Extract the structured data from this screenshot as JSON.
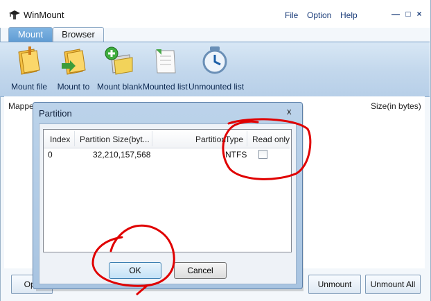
{
  "window": {
    "title": "WinMount"
  },
  "menu": {
    "file": "File",
    "option": "Option",
    "help": "Help"
  },
  "window_controls": {
    "minimize": "—",
    "maximize": "□",
    "close": "×"
  },
  "tabs": {
    "mount": "Mount",
    "browser": "Browser"
  },
  "toolbar": [
    {
      "label": "Mount file",
      "icon": "mount-file-icon"
    },
    {
      "label": "Mount to",
      "icon": "mount-to-icon"
    },
    {
      "label": "Mount blank",
      "icon": "mount-blank-icon"
    },
    {
      "label": "Mounted list",
      "icon": "mounted-list-icon"
    },
    {
      "label": "Unmounted list",
      "icon": "unmounted-list-icon"
    }
  ],
  "list": {
    "col_mapped": "Mappe",
    "col_size": "Size(in bytes)"
  },
  "bottom_buttons": {
    "open": "Ope",
    "unmount": "Unmount",
    "unmount_all": "Unmount All"
  },
  "dialog": {
    "title": "Partition",
    "close": "x",
    "columns": [
      "Index",
      "Partition Size(byt...",
      "Partition",
      "Type",
      "Read only"
    ],
    "rows": [
      {
        "index": "0",
        "size": "32,210,157,568",
        "type": "NTFS",
        "read_only": false
      }
    ],
    "ok": "OK",
    "cancel": "Cancel"
  },
  "colors": {
    "annotation": "#e00000",
    "accent": "#5f9bd3"
  }
}
